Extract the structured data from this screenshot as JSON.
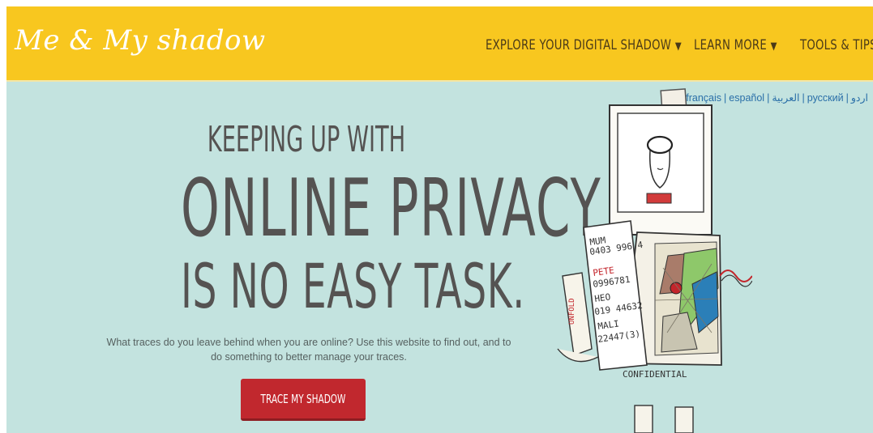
{
  "header": {
    "logo_text": "Me & My shadow",
    "nav": [
      {
        "label": "EXPLORE YOUR DIGITAL SHADOW",
        "caret": "▼"
      },
      {
        "label": "LEARN MORE",
        "caret": "▼"
      },
      {
        "label": "TOOLS & TIPS",
        "caret": ""
      }
    ]
  },
  "languages": [
    "français",
    "español",
    "العربية",
    "русский",
    "اردو"
  ],
  "hero": {
    "line1": "KEEPING UP WITH",
    "line2": "ONLINE PRIVACY",
    "line3": "IS NO EASY TASK.",
    "description": "What traces do you leave behind when you are online? Use this website to find out, and to do something to better manage your traces.",
    "cta_label": "TRACE MY SHADOW"
  },
  "illustration": {
    "note_lines": [
      "MUM",
      "0403 996 4",
      "PETE",
      "0996781",
      "HEO",
      "019 44632",
      "MALI",
      "22447(3)"
    ],
    "confidential_label": "CONFIDENTIAL",
    "arm_label": "UNFOLD"
  },
  "colors": {
    "header_bg": "#f8c71f",
    "hero_bg": "#c3e3df",
    "cta_bg": "#c1282e",
    "headline": "#555352",
    "link": "#2a6fa8"
  }
}
